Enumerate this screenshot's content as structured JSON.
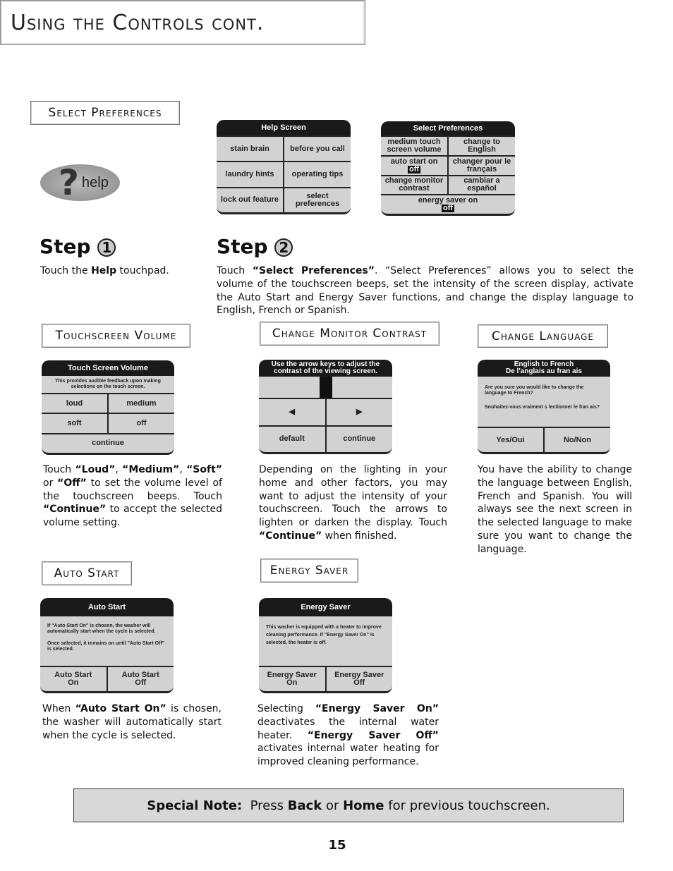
{
  "title": "Using the Controls cont.",
  "select_preferences_heading": "Select Preferences",
  "help_icon_label": "help",
  "help_screen": {
    "title": "Help Screen",
    "buttons": [
      "stain brain",
      "before you call",
      "laundry hints",
      "operating tips",
      "lock out feature",
      "select preferences"
    ]
  },
  "prefs_screen": {
    "title": "Select Preferences",
    "buttons": [
      "medium touch screen volume",
      "change to English",
      "auto start on",
      "changer pour le français",
      "change monitor contrast",
      "cambiar a español",
      "energy saver on"
    ],
    "off": "off"
  },
  "step1": {
    "label": "Step",
    "num": "1",
    "pre": "Touch the ",
    "bold": "Help",
    "post": " touchpad."
  },
  "step2": {
    "label": "Step",
    "num": "2",
    "pre": "Touch ",
    "bold": "“Select Preferences”",
    "post": ".  “Select Preferences” allows you to select the volume of the touchscreen beeps, set the intensity of the screen display, activate the Auto Start and Energy Saver functions, and change the display language to English, French or Spanish."
  },
  "volume": {
    "heading": "Touchscreen Volume",
    "screen_title": "Touch Screen Volume",
    "msg": "This provides audible feedback upon making selections on the touch screen.",
    "buttons": [
      "loud",
      "medium",
      "soft",
      "off",
      "continue"
    ],
    "text": [
      "Touch ",
      "“Loud”",
      ", ",
      "“Medium”",
      ", ",
      "“Soft”",
      " or ",
      "“Off”",
      " to set the volume level of the touchscreen beeps. Touch ",
      "“Continue”",
      " to accept the selected volume setting."
    ]
  },
  "contrast": {
    "heading": "Change Monitor Contrast",
    "screen_title": "Use the arrow keys to adjust the contrast of the viewing screen.",
    "buttons": [
      "default",
      "continue"
    ],
    "text": [
      "Depending on the lighting in your home and other factors, you may want to adjust the intensity of your touchscreen. Touch the arrows to lighten or darken the display. Touch ",
      "“Continue”",
      " when finished."
    ]
  },
  "language": {
    "heading": "Change Language",
    "screen_title_1": "English to French",
    "screen_title_2": "De l'anglais au fran ais",
    "msg1": "Are you sure you would like to change the language to French?",
    "msg2": "Souhaitez-vous vraiment s lectionner le fran ais?",
    "buttons": [
      "Yes/Oui",
      "No/Non"
    ],
    "text": "You have the ability to change the language between English, French and Spanish. You will always see the next screen in the selected language to make sure you want to change the language."
  },
  "autostart": {
    "heading": "Auto Start",
    "screen_title": "Auto Start",
    "msg1": "If \"Auto Start On\" is chosen, the washer will automatically start when the cycle is selected.",
    "msg2": "Once selected, it remains on until \"Auto Start Off\" is selected.",
    "buttons": [
      "Auto Start On",
      "Auto Start Off"
    ],
    "text": [
      "When ",
      "“Auto Start On”",
      " is chosen, the washer will automatically start when the cycle is selected."
    ]
  },
  "energy": {
    "heading": "Energy Saver",
    "screen_title": "Energy Saver",
    "msg": "This washer is equipped with a heater to improve cleaning performance. If \"Energy Saver On\" is selected, the heater is off.",
    "buttons": [
      "Energy Saver On",
      "Energy Saver Off"
    ],
    "text": [
      "Selecting ",
      "“Energy Saver On”",
      " deactivates the internal water heater. ",
      "“Energy Saver Off”",
      " activates internal water heating for improved cleaning performance."
    ]
  },
  "note": {
    "bold1": "Special Note:",
    "t1": "  Press ",
    "bold2": "Back",
    "t2": " or ",
    "bold3": "Home",
    "t3": " for previous touchscreen."
  },
  "page_number": "15"
}
